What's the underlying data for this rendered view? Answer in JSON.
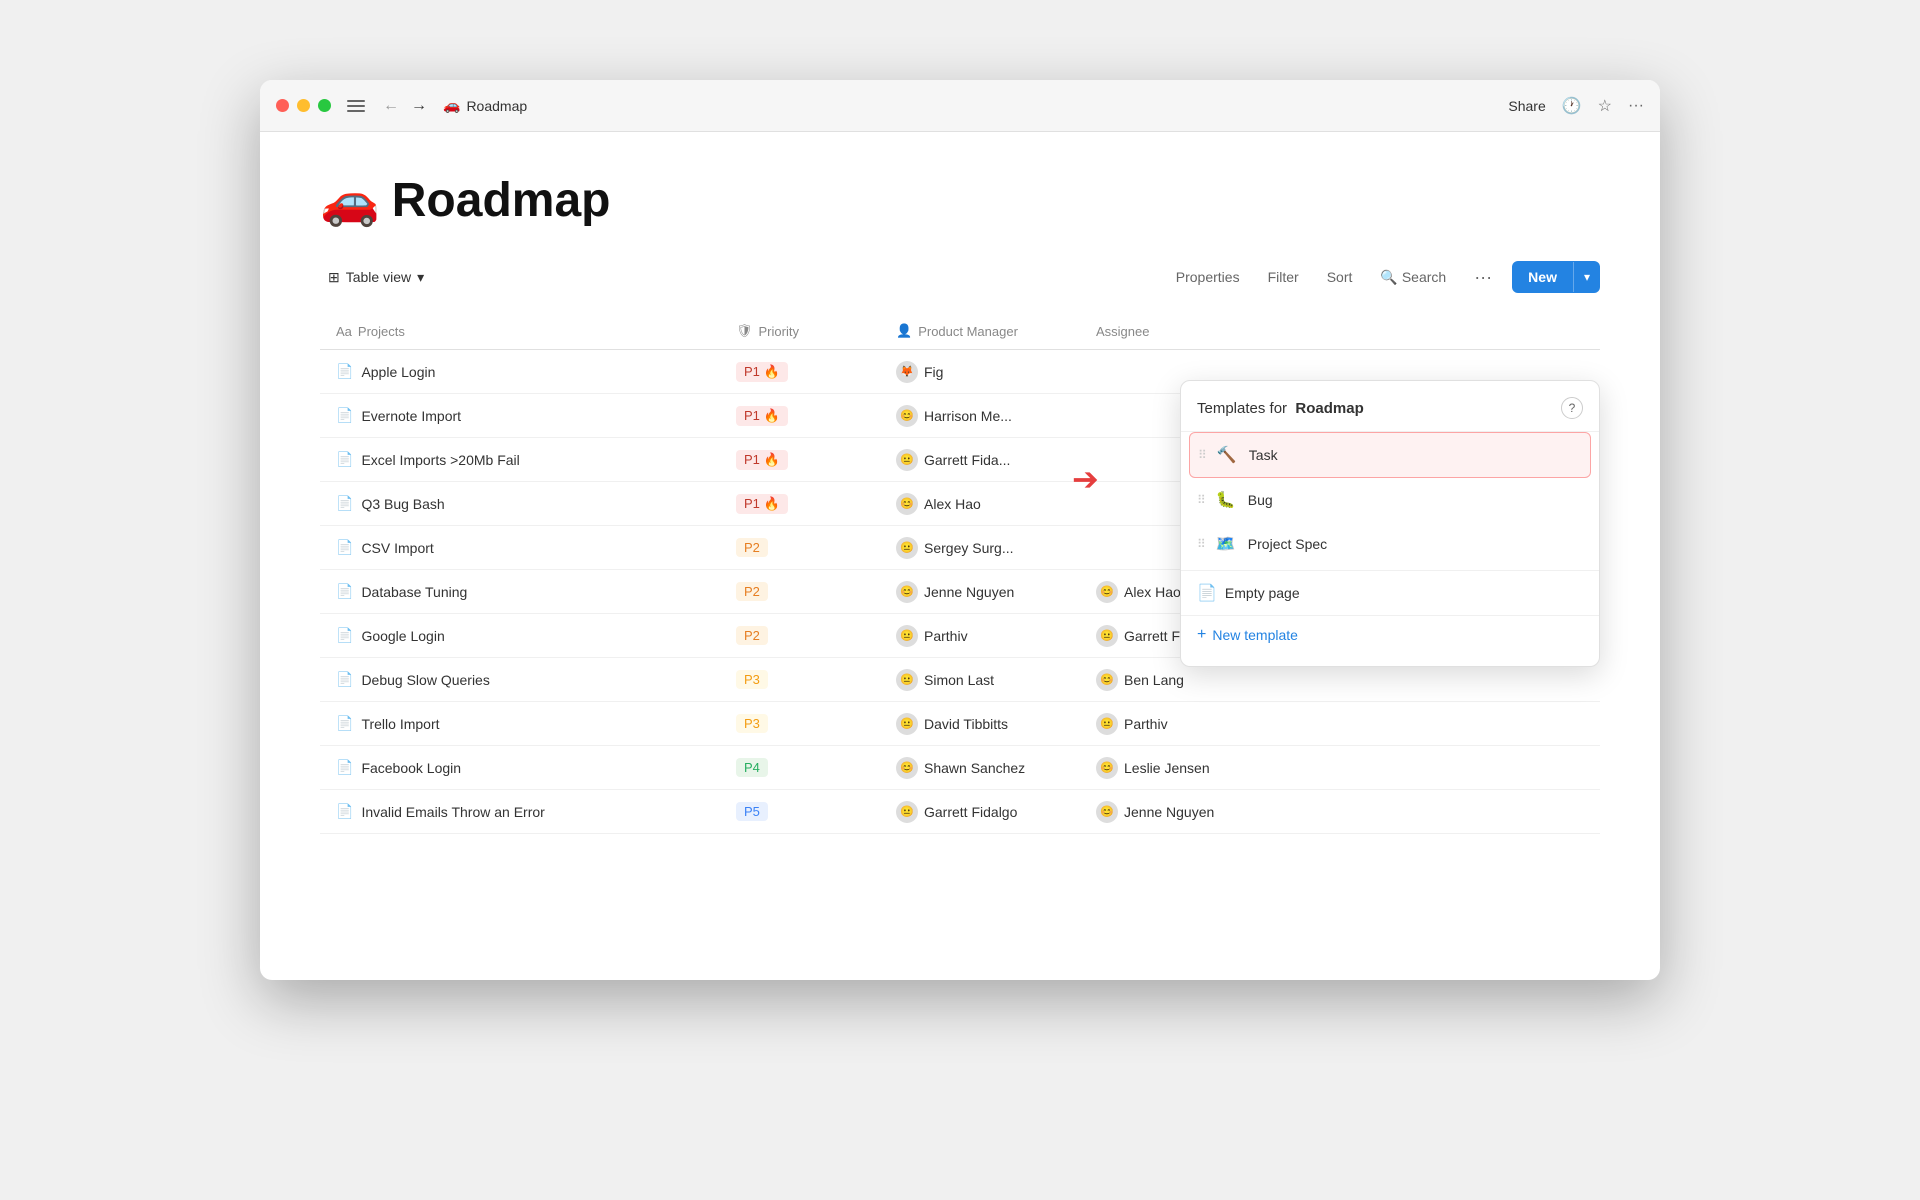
{
  "window": {
    "title": "Roadmap",
    "emoji": "🚗"
  },
  "titlebar": {
    "title": "Roadmap",
    "share_label": "Share",
    "more_label": "···"
  },
  "toolbar": {
    "view_label": "Table view",
    "properties_label": "Properties",
    "filter_label": "Filter",
    "sort_label": "Sort",
    "search_label": "Search",
    "more_label": "···",
    "new_label": "New"
  },
  "table": {
    "columns": [
      "Projects",
      "Priority",
      "Product Manager",
      "Assignee"
    ],
    "rows": [
      {
        "name": "Apple Login",
        "priority": "P1",
        "priority_class": "p1",
        "fire": "🔥",
        "manager": "Fig",
        "assignee": ""
      },
      {
        "name": "Evernote Import",
        "priority": "P1",
        "priority_class": "p1",
        "fire": "🔥",
        "manager": "Harrison Me...",
        "assignee": ""
      },
      {
        "name": "Excel Imports >20Mb Fail",
        "priority": "P1",
        "priority_class": "p1",
        "fire": "🔥",
        "manager": "Garrett Fida...",
        "assignee": ""
      },
      {
        "name": "Q3 Bug Bash",
        "priority": "P1",
        "priority_class": "p1",
        "fire": "🔥",
        "manager": "Alex Hao",
        "assignee": ""
      },
      {
        "name": "CSV Import",
        "priority": "P2",
        "priority_class": "p2",
        "fire": "",
        "manager": "Sergey Surg...",
        "assignee": ""
      },
      {
        "name": "Database Tuning",
        "priority": "P2",
        "priority_class": "p2",
        "fire": "",
        "manager": "Jenne Nguyen",
        "assignee": "Alex Hao"
      },
      {
        "name": "Google Login",
        "priority": "P2",
        "priority_class": "p2",
        "fire": "",
        "manager": "Parthiv",
        "assignee": "Garrett Fidalgo"
      },
      {
        "name": "Debug Slow Queries",
        "priority": "P3",
        "priority_class": "p3",
        "fire": "",
        "manager": "Simon Last",
        "assignee": "Ben Lang"
      },
      {
        "name": "Trello Import",
        "priority": "P3",
        "priority_class": "p3",
        "fire": "",
        "manager": "David Tibbitts",
        "assignee": "Parthiv"
      },
      {
        "name": "Facebook Login",
        "priority": "P4",
        "priority_class": "p4",
        "fire": "",
        "manager": "Shawn Sanchez",
        "assignee": "Leslie Jensen"
      },
      {
        "name": "Invalid Emails Throw an Error",
        "priority": "P5",
        "priority_class": "p5",
        "fire": "",
        "manager": "Garrett Fidalgo",
        "assignee": "Jenne Nguyen"
      }
    ]
  },
  "templates": {
    "title_prefix": "Templates for",
    "title_name": "Roadmap",
    "items": [
      {
        "name": "Task",
        "icon": "🔨"
      },
      {
        "name": "Bug",
        "icon": "🐛"
      },
      {
        "name": "Project Spec",
        "icon": "🗺️"
      }
    ],
    "empty_page_label": "Empty page",
    "new_template_label": "New template"
  }
}
